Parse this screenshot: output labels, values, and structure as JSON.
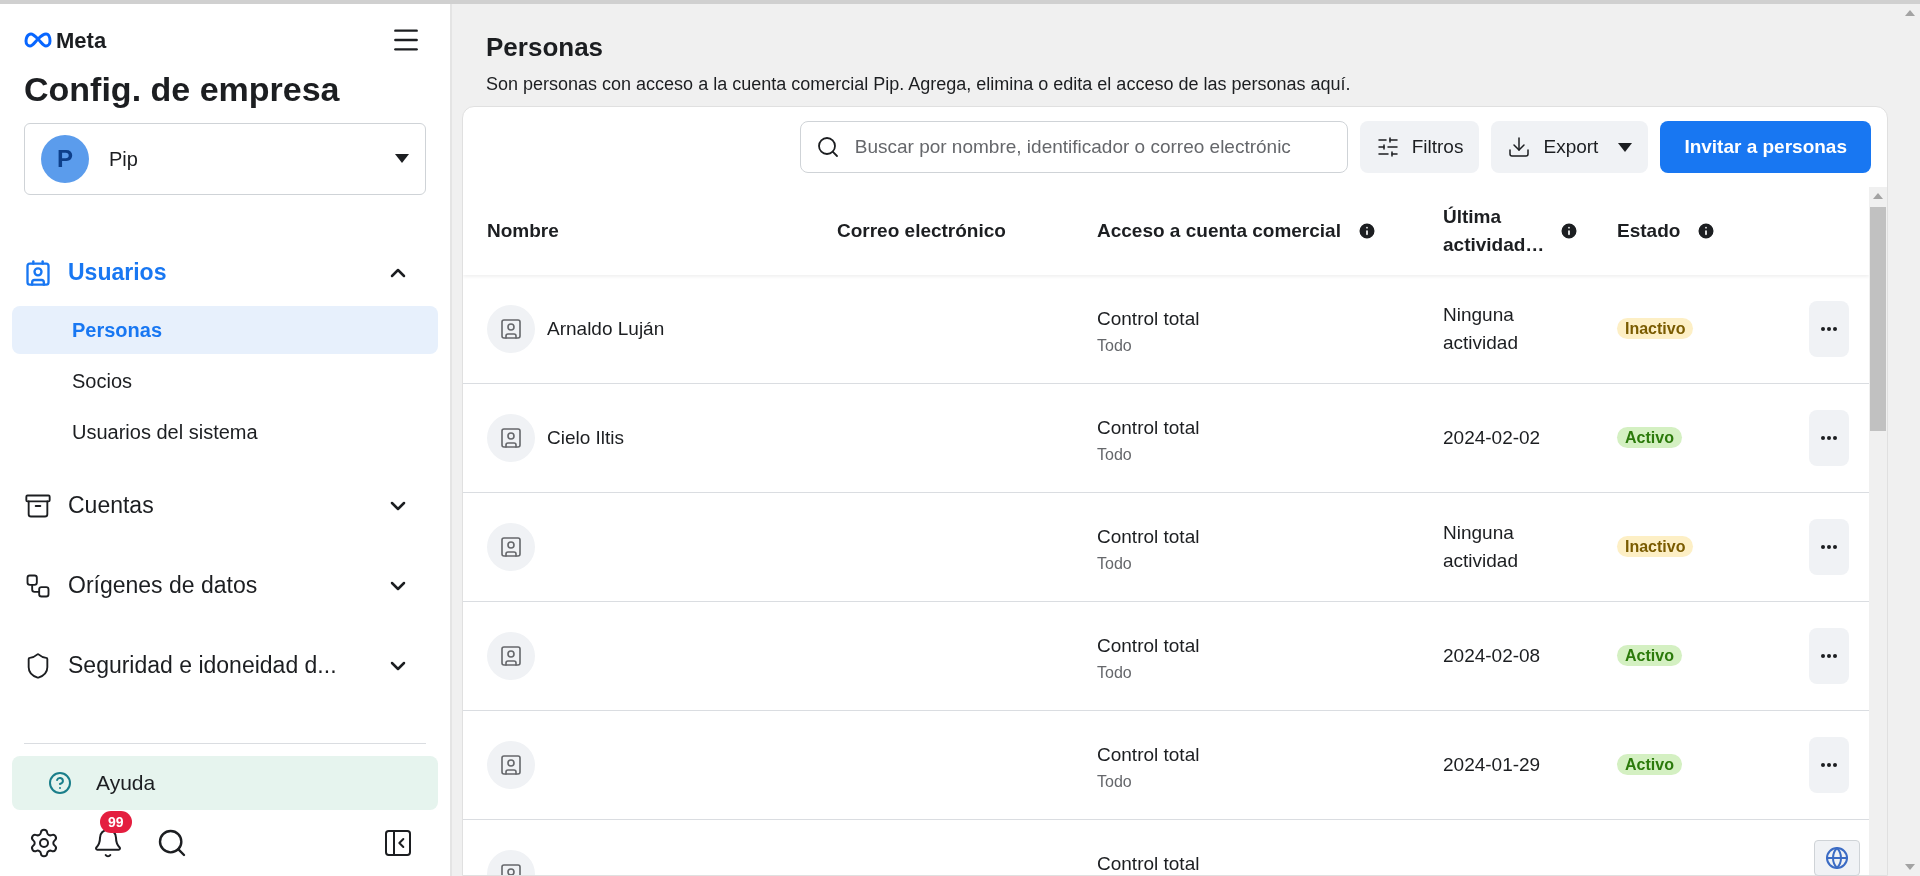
{
  "sidebar": {
    "brand": "Meta",
    "title": "Config. de empresa",
    "account": {
      "initial": "P",
      "name": "Pip"
    },
    "sections": [
      {
        "label": "Usuarios",
        "expanded": true,
        "children": [
          {
            "label": "Personas",
            "selected": true
          },
          {
            "label": "Socios",
            "selected": false
          },
          {
            "label": "Usuarios del sistema",
            "selected": false
          }
        ]
      },
      {
        "label": "Cuentas",
        "expanded": false
      },
      {
        "label": "Orígenes de datos",
        "expanded": false
      },
      {
        "label": "Seguridad e idoneidad d...",
        "expanded": false
      }
    ],
    "help": "Ayuda",
    "notification_count": "99"
  },
  "page": {
    "title": "Personas",
    "subtitle": "Son personas con acceso a la cuenta comercial Pip. Agrega, elimina o edita el acceso de las personas aquí."
  },
  "toolbar": {
    "search": {
      "placeholder": "Buscar por nombre, identificador o correo electrónic"
    },
    "filters": "Filtros",
    "export": "Export",
    "invite": "Invitar a personas"
  },
  "table": {
    "columns": [
      {
        "label": "Nombre",
        "info": false
      },
      {
        "label": "Correo electrónico",
        "info": false
      },
      {
        "label": "Acceso a cuenta comercial",
        "info": true
      },
      {
        "label": "Última actividad…",
        "info": true
      },
      {
        "label": "Estado",
        "info": true
      }
    ],
    "rows": [
      {
        "name": "Arnaldo Luján",
        "access": "Control total",
        "scope": "Todo",
        "activity": "Ninguna actividad",
        "status": {
          "label": "Inactivo",
          "kind": "inactive"
        }
      },
      {
        "name": "Cielo Iltis",
        "access": "Control total",
        "scope": "Todo",
        "activity": "2024-02-02",
        "status": {
          "label": "Activo",
          "kind": "active"
        }
      },
      {
        "access": "Control total",
        "scope": "Todo",
        "activity": "Ninguna actividad",
        "status": {
          "label": "Inactivo",
          "kind": "inactive"
        }
      },
      {
        "access": "Control total",
        "scope": "Todo",
        "activity": "2024-02-08",
        "status": {
          "label": "Activo",
          "kind": "active"
        }
      },
      {
        "access": "Control total",
        "scope": "Todo",
        "activity": "2024-01-29",
        "status": {
          "label": "Activo",
          "kind": "active"
        }
      },
      {
        "access": "Control total"
      }
    ]
  }
}
